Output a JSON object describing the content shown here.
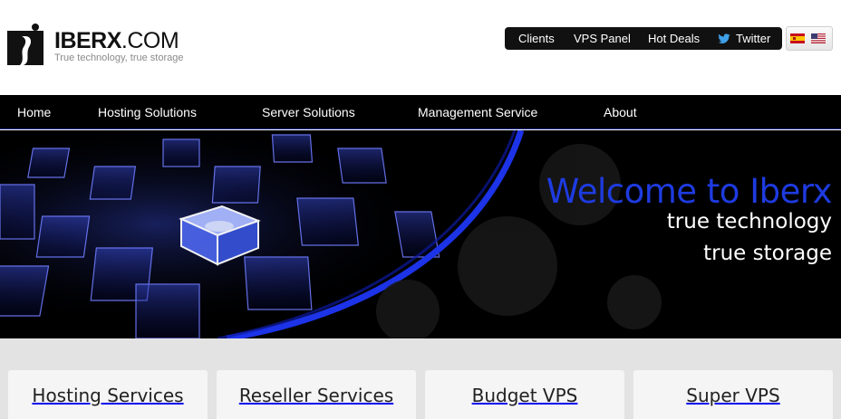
{
  "brand": {
    "name_bold": "IBERX",
    "name_rest": ".COM",
    "tagline": "True technology, true storage"
  },
  "top_links": {
    "clients": "Clients",
    "vps_panel": "VPS Panel",
    "hot_deals": "Hot Deals",
    "twitter": "Twitter",
    "twitter_icon": "twitter-bird-icon"
  },
  "languages": [
    {
      "icon": "spain-flag-icon"
    },
    {
      "icon": "us-flag-icon"
    }
  ],
  "nav": {
    "home": "Home",
    "hosting": "Hosting Solutions",
    "server": "Server Solutions",
    "management": "Management Service",
    "about": "About"
  },
  "hero": {
    "title": "Welcome to Iberx",
    "line1": "true technology",
    "line2": "true storage"
  },
  "services": [
    {
      "label": "Hosting Services"
    },
    {
      "label": "Reseller Services"
    },
    {
      "label": "Budget VPS"
    },
    {
      "label": "Super VPS"
    }
  ],
  "colors": {
    "accent_blue": "#1e3be0",
    "nav_bg": "#000000",
    "services_bg": "#e3e3e3"
  }
}
